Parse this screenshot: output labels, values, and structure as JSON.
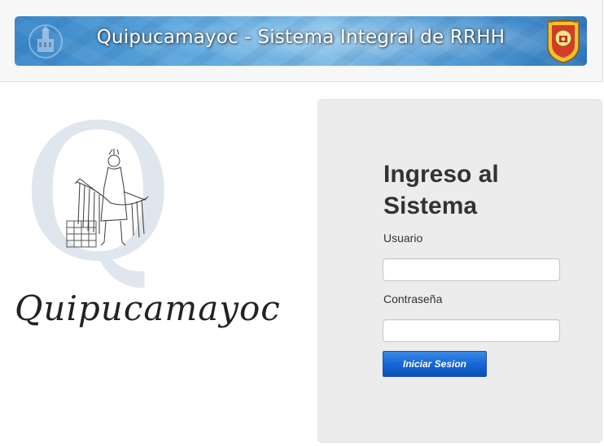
{
  "header": {
    "title": "Quipucamayoc - Sistema Integral de RRHH"
  },
  "logo": {
    "letter": "Q",
    "wordmark": "Quipucamayoc"
  },
  "login": {
    "heading": "Ingreso al Sistema",
    "username_label": "Usuario",
    "username_value": "",
    "password_label": "Contraseña",
    "password_value": "",
    "submit_label": "Iniciar Sesion"
  },
  "colors": {
    "banner": "#4c97d3",
    "panel": "#ececec",
    "button": "#1567d6"
  }
}
